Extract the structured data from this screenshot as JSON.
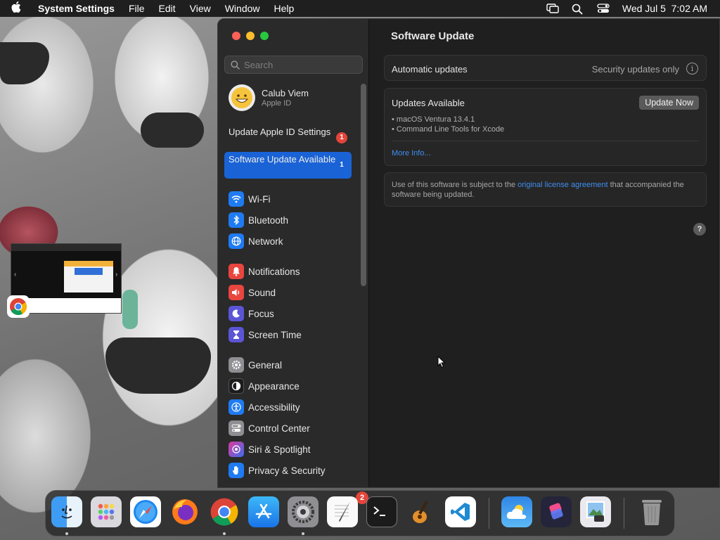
{
  "menubar": {
    "app_name": "System Settings",
    "menus": [
      "File",
      "Edit",
      "View",
      "Window",
      "Help"
    ],
    "clock": "Wed Jul 5  7:02 AM"
  },
  "sidebar": {
    "search_placeholder": "Search",
    "account": {
      "name": "Calub Viem",
      "subtitle": "Apple ID",
      "avatar_icon": "grinning-face-emoji"
    },
    "notices": [
      {
        "label": "Update Apple ID Settings",
        "badge": "1",
        "selected": false
      },
      {
        "label": "Software Update Available",
        "badge": "1",
        "selected": true
      }
    ],
    "groups": [
      [
        {
          "label": "Wi-Fi",
          "icon": "wifi-icon",
          "color": "#1f7bf2"
        },
        {
          "label": "Bluetooth",
          "icon": "bluetooth-icon",
          "color": "#1f7bf2"
        },
        {
          "label": "Network",
          "icon": "globe-icon",
          "color": "#1f7bf2"
        }
      ],
      [
        {
          "label": "Notifications",
          "icon": "bell-icon",
          "color": "#e8463f"
        },
        {
          "label": "Sound",
          "icon": "speaker-icon",
          "color": "#e8463f"
        },
        {
          "label": "Focus",
          "icon": "moon-icon",
          "color": "#5b55d6"
        },
        {
          "label": "Screen Time",
          "icon": "hourglass-icon",
          "color": "#5b55d6"
        }
      ],
      [
        {
          "label": "General",
          "icon": "gear-icon",
          "color": "#8e8e93"
        },
        {
          "label": "Appearance",
          "icon": "appearance-icon",
          "color": "#1c1c1e"
        },
        {
          "label": "Accessibility",
          "icon": "accessibility-icon",
          "color": "#1f7bf2"
        },
        {
          "label": "Control Center",
          "icon": "control-center-icon",
          "color": "#8e8e93"
        },
        {
          "label": "Siri & Spotlight",
          "icon": "siri-icon",
          "color": "#b44bd8"
        },
        {
          "label": "Privacy & Security",
          "icon": "hand-icon",
          "color": "#1f7bf2"
        }
      ]
    ]
  },
  "main": {
    "title": "Software Update",
    "automatic": {
      "label": "Automatic updates",
      "value": "Security updates only"
    },
    "updates": {
      "title": "Updates Available",
      "button": "Update Now",
      "items": [
        "• macOS Ventura 13.4.1",
        "• Command Line Tools for Xcode"
      ],
      "more_info": "More Info..."
    },
    "license": {
      "prefix": "Use of this software is subject to the ",
      "link": "original license agreement",
      "suffix": " that accompanied the software being updated."
    },
    "help": "?"
  },
  "dock": {
    "settings_badge": "2",
    "apps": [
      "finder-icon",
      "launchpad-icon",
      "safari-icon",
      "firefox-icon",
      "chrome-icon",
      "app-store-icon",
      "system-settings-icon",
      "textedit-icon",
      "terminal-icon",
      "garageband-icon",
      "vscode-icon",
      "weather-icon",
      "shortcuts-icon",
      "preview-icon",
      "trash-icon"
    ]
  },
  "colors": {
    "accent": "#1a63d6",
    "link": "#3f8ef0",
    "badge": "#e3453b"
  }
}
